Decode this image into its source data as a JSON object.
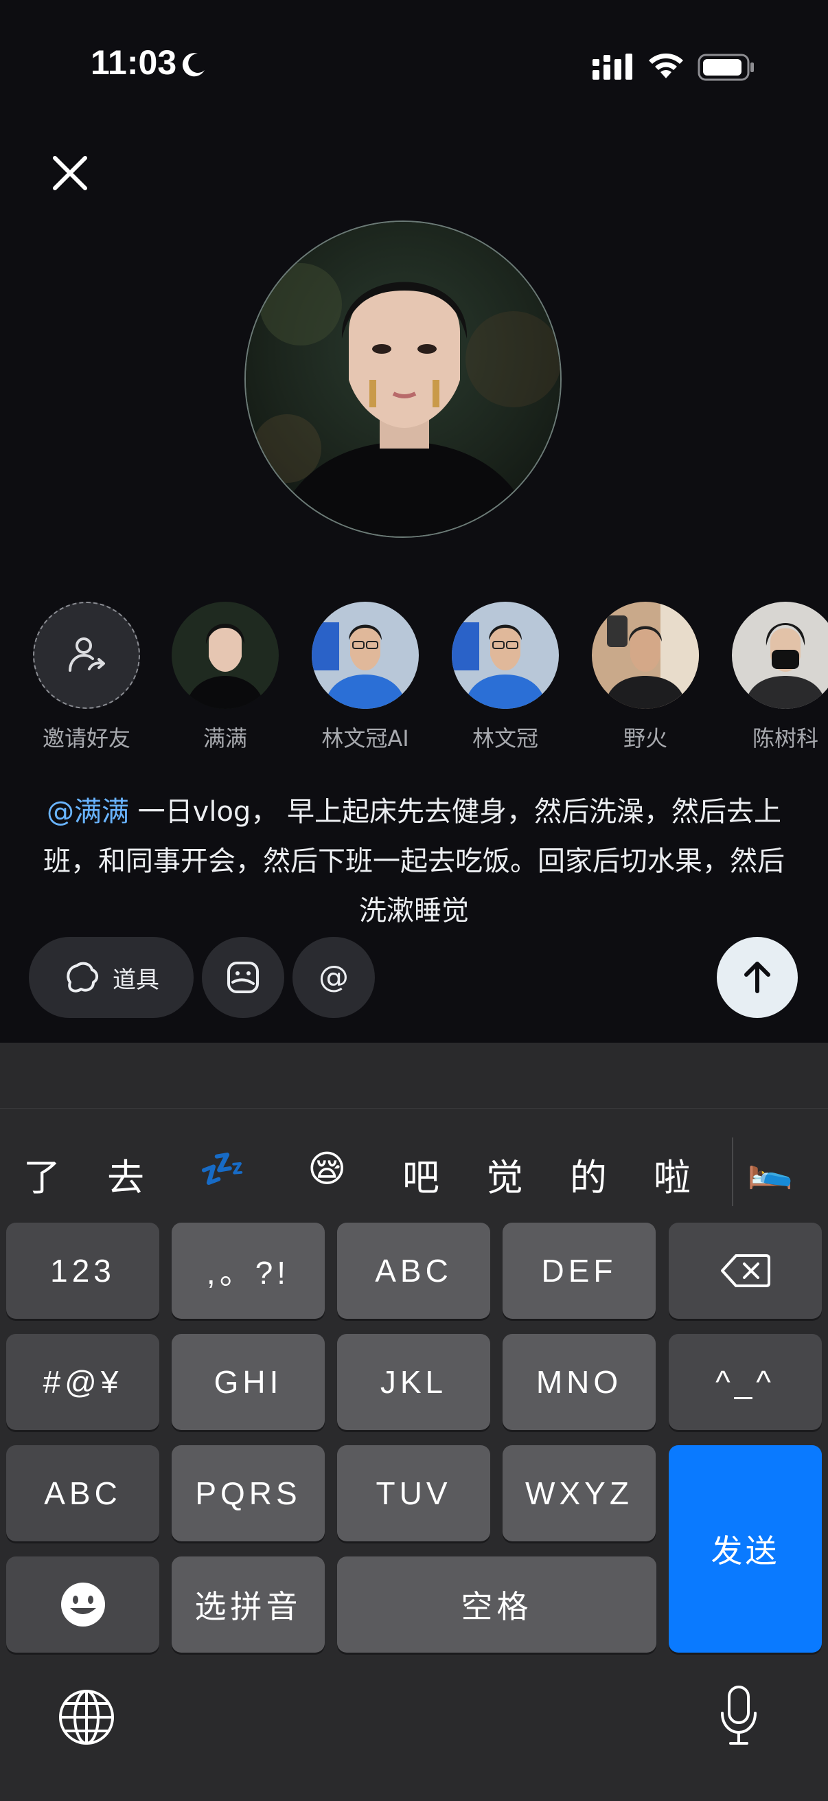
{
  "status": {
    "time": "11:03"
  },
  "friends": [
    {
      "name": "邀请好友",
      "type": "invite"
    },
    {
      "name": "满满"
    },
    {
      "name": "林文冠AI"
    },
    {
      "name": "林文冠"
    },
    {
      "name": "野火"
    },
    {
      "name": "陈树科"
    }
  ],
  "caption": {
    "mention": "@满满",
    "text": " 一日vlog， 早上起床先去健身，然后洗澡，然后去上班，和同事开会，然后下班一起去吃饭。回家后切水果，然后洗漱睡觉"
  },
  "tools": {
    "props_label": "道具"
  },
  "keyboard": {
    "candidates": [
      "了",
      "去",
      "💤",
      "😪",
      "吧",
      "觉",
      "的",
      "啦",
      "🛌"
    ],
    "keys": {
      "k123": "123",
      "punct": ",。?!",
      "abc1": "ABC",
      "def": "DEF",
      "sym": "#@¥",
      "ghi": "GHI",
      "jkl": "JKL",
      "mno": "MNO",
      "emoticon": "^_^",
      "abc2": "ABC",
      "pqrs": "PQRS",
      "tuv": "TUV",
      "wxyz": "WXYZ",
      "send": "发送",
      "pinyin": "选拼音",
      "space": "空格"
    }
  },
  "colors": {
    "accent": "#0a7aff",
    "mention": "#69b4ff",
    "background": "#0d0d11"
  }
}
